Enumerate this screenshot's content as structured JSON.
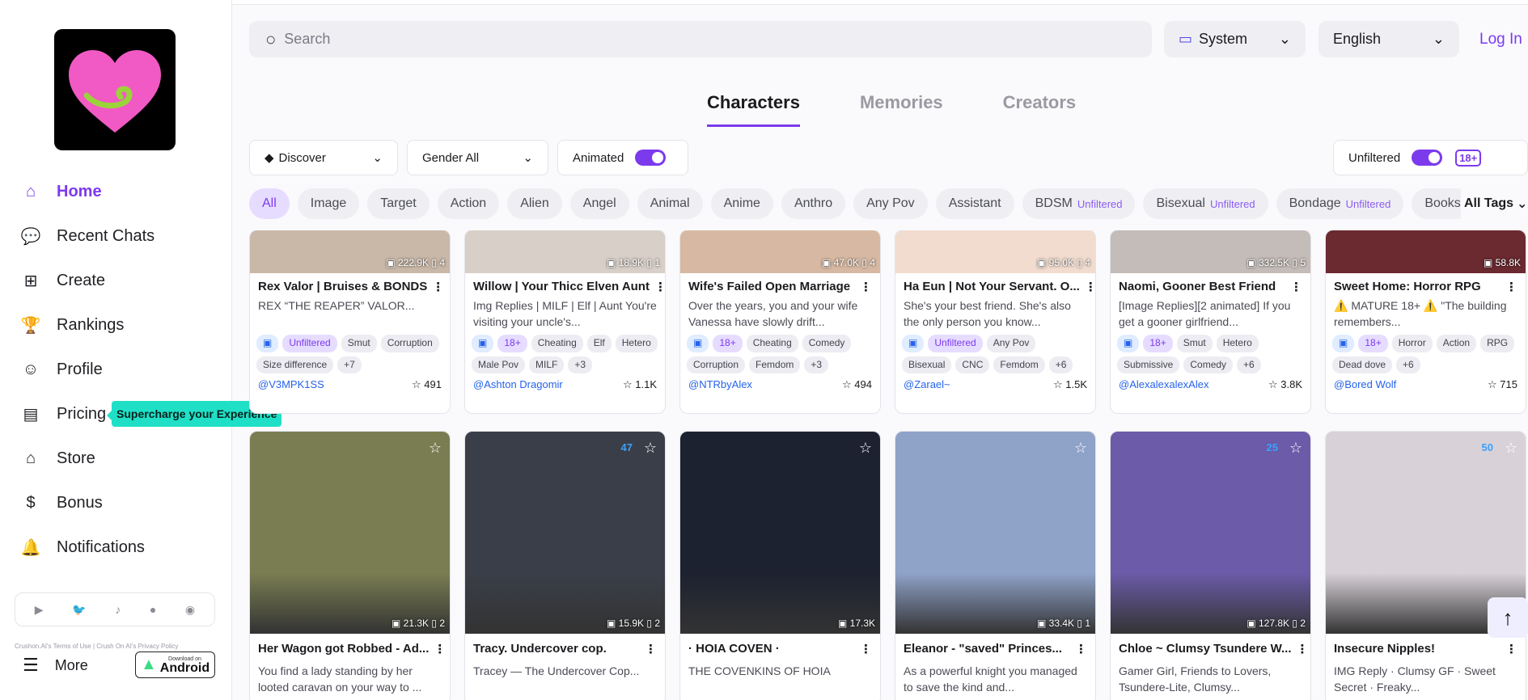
{
  "sidebar": {
    "nav": [
      {
        "label": "Home",
        "icon": "home-icon",
        "active": true
      },
      {
        "label": "Recent Chats",
        "icon": "chat-icon"
      },
      {
        "label": "Create",
        "icon": "plus-square-icon"
      },
      {
        "label": "Rankings",
        "icon": "trophy-icon"
      },
      {
        "label": "Profile",
        "icon": "profile-icon"
      },
      {
        "label": "Pricing",
        "icon": "card-icon"
      },
      {
        "label": "Store",
        "icon": "store-icon"
      },
      {
        "label": "Bonus",
        "icon": "dollar-icon"
      },
      {
        "label": "Notifications",
        "icon": "bell-icon"
      }
    ],
    "tooltip": "Supercharge your Experience",
    "social": [
      "youtube-icon",
      "twitter-icon",
      "tiktok-icon",
      "reddit-icon",
      "discord-icon"
    ],
    "footer": "Crushon.AI's Terms of Use  |  Crush On AI's Privacy Policy",
    "more": "More",
    "android_small": "Download on",
    "android": "Android"
  },
  "header": {
    "search_placeholder": "Search",
    "theme": "System",
    "language": "English",
    "login": "Log In"
  },
  "tabs": [
    "Characters",
    "Memories",
    "Creators"
  ],
  "filters": {
    "discover": "Discover",
    "gender": "Gender All",
    "animated": "Animated",
    "unfiltered": "Unfiltered",
    "badge": "18+"
  },
  "tags": [
    {
      "label": "All",
      "active": true
    },
    {
      "label": "Image"
    },
    {
      "label": "Target"
    },
    {
      "label": "Action"
    },
    {
      "label": "Alien"
    },
    {
      "label": "Angel"
    },
    {
      "label": "Animal"
    },
    {
      "label": "Anime"
    },
    {
      "label": "Anthro"
    },
    {
      "label": "Any Pov"
    },
    {
      "label": "Assistant"
    },
    {
      "label": "BDSM",
      "uf": "Unfiltered"
    },
    {
      "label": "Bisexual",
      "uf": "Unfiltered"
    },
    {
      "label": "Bondage",
      "uf": "Unfiltered"
    },
    {
      "label": "Books"
    }
  ],
  "all_tags": "All Tags",
  "row1": [
    {
      "views": "222.9K",
      "saves": "4",
      "title": "Rex Valor | Bruises & BONDS",
      "desc": "REX “THE REAPER” VALOR...",
      "chips": [
        [
          "Unfiltered",
          "p"
        ],
        [
          "Smut",
          ""
        ],
        [
          "Corruption",
          ""
        ],
        [
          "Size difference",
          ""
        ],
        [
          "+7",
          ""
        ]
      ],
      "author": "@V3MPK1SS",
      "likes": "491",
      "bg": "#c9b8a8"
    },
    {
      "views": "18.9K",
      "saves": "1",
      "title": "Willow | Your Thicc Elven Aunt",
      "desc": "Img Replies | MILF | Elf | Aunt You're visiting your uncle's...",
      "chips": [
        [
          "18+",
          "p"
        ],
        [
          "Cheating",
          ""
        ],
        [
          "Elf",
          ""
        ],
        [
          "Hetero",
          ""
        ],
        [
          "Male Pov",
          ""
        ],
        [
          "MILF",
          ""
        ],
        [
          "+3",
          ""
        ]
      ],
      "author": "@Ashton Dragomir",
      "likes": "1.1K",
      "bg": "#d8d0c8"
    },
    {
      "views": "47.0K",
      "saves": "4",
      "title": "Wife's Failed Open Marriage",
      "desc": "Over the years, you and your wife Vanessa have slowly drift...",
      "chips": [
        [
          "18+",
          "p"
        ],
        [
          "Cheating",
          ""
        ],
        [
          "Comedy",
          ""
        ],
        [
          "Corruption",
          ""
        ],
        [
          "Femdom",
          ""
        ],
        [
          "+3",
          ""
        ]
      ],
      "author": "@NTRbyAlex",
      "likes": "494",
      "bg": "#d7b9a3"
    },
    {
      "views": "95.0K",
      "saves": "4",
      "title": "Ha Eun | Not Your Servant. O...",
      "desc": "She's your best friend. She's also the only person you know...",
      "chips": [
        [
          "Unfiltered",
          "p"
        ],
        [
          "Any Pov",
          ""
        ],
        [
          "Bisexual",
          ""
        ],
        [
          "CNC",
          ""
        ],
        [
          "Femdom",
          ""
        ],
        [
          "+6",
          ""
        ]
      ],
      "author": "@Zarael~",
      "likes": "1.5K",
      "bg": "#f1dccf"
    },
    {
      "views": "332.5K",
      "saves": "5",
      "title": "Naomi, Gooner Best Friend",
      "desc": "[Image Replies][2 animated] If you get a gooner girlfriend...",
      "chips": [
        [
          "18+",
          "p"
        ],
        [
          "Smut",
          ""
        ],
        [
          "Hetero",
          ""
        ],
        [
          "Submissive",
          ""
        ],
        [
          "Comedy",
          ""
        ],
        [
          "+6",
          ""
        ]
      ],
      "author": "@AlexalexalexAlex",
      "likes": "3.8K",
      "bg": "#c4bcb8"
    },
    {
      "views": "58.8K",
      "saves": "",
      "title": "Sweet Home: Horror RPG",
      "desc": "⚠️ MATURE 18+ ⚠️ \"The building remembers...",
      "chips": [
        [
          "18+",
          "p"
        ],
        [
          "Horror",
          ""
        ],
        [
          "Action",
          ""
        ],
        [
          "RPG",
          ""
        ],
        [
          "Dead dove",
          ""
        ],
        [
          "+6",
          ""
        ]
      ],
      "author": "@Bored Wolf",
      "likes": "715",
      "bg": "#6a2a30"
    }
  ],
  "row2": [
    {
      "views": "21.3K",
      "saves": "2",
      "title": "Her Wagon got Robbed - Ad...",
      "desc": "You find a lady standing by her looted caravan on your way to ...",
      "bg": "#7a7d52"
    },
    {
      "views": "15.9K",
      "saves": "2",
      "title": "Tracy. Undercover cop.",
      "desc": "Tracey — The Undercover Cop...",
      "badge": "47",
      "bg": "#3a3e48"
    },
    {
      "views": "17.3K",
      "saves": "",
      "title": "· HOIA COVEN ·",
      "desc": "THE COVENKINS OF HOIA",
      "bg": "#1d2230"
    },
    {
      "views": "33.4K",
      "saves": "1",
      "title": "Eleanor - \"saved\" Princes...",
      "desc": "As a powerful knight you managed to save the kind and...",
      "bg": "#8fa2c8"
    },
    {
      "views": "127.8K",
      "saves": "2",
      "title": "Chloe ~ Clumsy Tsundere W...",
      "desc": "Gamer Girl, Friends to Lovers, Tsundere-Lite, Clumsy...",
      "badge": "25",
      "bg": "#6b5ba8"
    },
    {
      "views": "",
      "saves": "",
      "title": "Insecure Nipples!",
      "desc": "IMG Reply · Clumsy GF · Sweet Secret · Freaky...",
      "badge": "50",
      "bg": "#d8d2d8"
    }
  ]
}
